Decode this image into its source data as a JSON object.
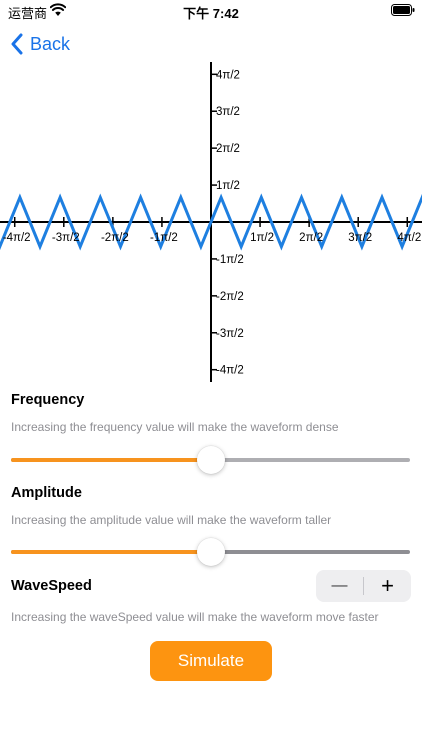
{
  "status_bar": {
    "carrier": "运营商",
    "time": "下午 7:42",
    "wifi_icon": "wifi-icon",
    "battery_icon": "battery-icon"
  },
  "nav": {
    "back_label": "Back",
    "back_icon": "chevron-left-icon"
  },
  "chart_data": {
    "type": "line",
    "title": "",
    "xlabel": "",
    "ylabel": "",
    "x_tick_labels": [
      "-4π/2",
      "-3π/2",
      "-2π/2",
      "-1π/2",
      "1π/2",
      "2π/2",
      "3π/2",
      "4π/2"
    ],
    "y_tick_labels": [
      "4π/2",
      "3π/2",
      "2π/2",
      "1π/2",
      "-1π/2",
      "-2π/2",
      "-3π/2",
      "-4π/2"
    ],
    "xlim": [
      -8.6,
      8.6
    ],
    "ylim": [
      -6.5,
      6.5
    ],
    "series": [
      {
        "waveform": "triangle",
        "amplitude": 1.0,
        "period": 1.64,
        "color": "#1e7fe0"
      }
    ],
    "grid": false,
    "legend": "none"
  },
  "controls": {
    "frequency": {
      "title": "Frequency",
      "description": "Increasing the frequency value will make the waveform dense",
      "value_fraction": 0.5
    },
    "amplitude": {
      "title": "Amplitude",
      "description": "Increasing the amplitude value will make the waveform taller",
      "value_fraction": 0.5
    },
    "wavespeed": {
      "title": "WaveSpeed",
      "description": "Increasing the waveSpeed value will make the waveform move faster",
      "minus_label": "—",
      "plus_label": "+"
    }
  },
  "simulate_label": "Simulate",
  "colors": {
    "accent": "#1a73e8",
    "slider_fill": "#f7931e",
    "button": "#fd9410",
    "wave": "#1e7fe0"
  }
}
